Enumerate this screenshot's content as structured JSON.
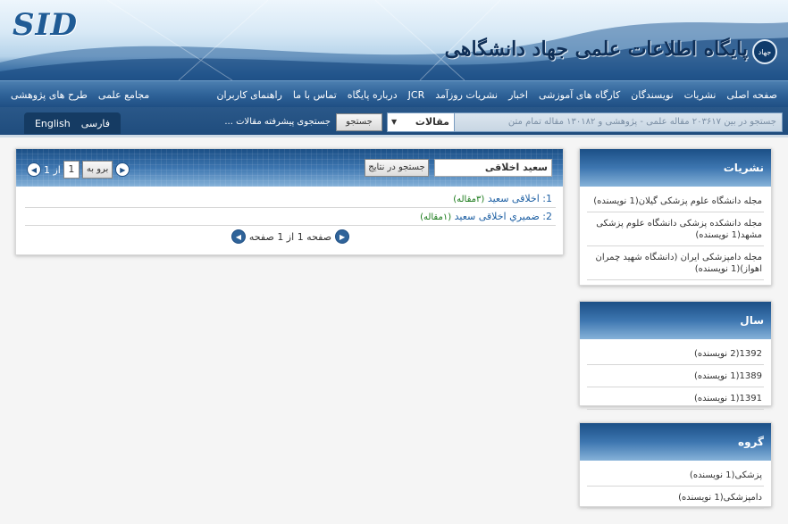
{
  "banner": {
    "logo": "SID",
    "title": "پایگاه اطلاعات علمی جهاد دانشگاهی",
    "emblem": "جهاد"
  },
  "nav": {
    "right_items": [
      "صفحه اصلی",
      "نشریات",
      "نویسندگان",
      "کارگاه های آموزشی",
      "اخبار",
      "نشریات روزآمد",
      "JCR",
      "درباره پایگاه",
      "تماس با ما",
      "راهنمای کاربران"
    ],
    "left_items": [
      "مجامع علمی",
      "طرح های پژوهشی"
    ]
  },
  "search": {
    "placeholder": "جستجو در بین ۲۰۳۶۱۷ مقاله علمی - پژوهشی و ۱۳۰۱۸۲ مقاله تمام متن",
    "type_value": "مقالات",
    "button": "جستجو",
    "advanced": "جستجوی پیشرفته مقالات ...",
    "lang_fa": "فارسی",
    "lang_en": "English"
  },
  "results": {
    "query": "سعید اخلاقی",
    "search_in_results": "جستجو در نتایج",
    "go_label": "برو به",
    "page_value": "1",
    "of_label": "از 1",
    "rows": [
      {
        "num": "1:",
        "name": "اخلاقی سعید",
        "count": "(۳مقاله)"
      },
      {
        "num": "2:",
        "name": "ضميري اخلاقی سعید",
        "count": "(۱مقاله)"
      }
    ],
    "page_status": "صفحه 1 از 1 صفحه"
  },
  "sidebar": {
    "journals": {
      "title": "نشریات",
      "items": [
        "مجله دانشگاه علوم پزشکی گیلان(1 نویسنده)",
        "مجله دانشکده پزشکی دانشگاه علوم پزشکی مشهد(1 نویسنده)",
        "مجله دامپزشکی ایران (دانشگاه شهید چمران اهواز)(1 نویسنده)"
      ]
    },
    "year": {
      "title": "سال",
      "items": [
        "1392(2 نویسنده)",
        "1389(1 نویسنده)",
        "1391(1 نویسنده)"
      ]
    },
    "group": {
      "title": "گروه",
      "items": [
        "پزشکی(1 نویسنده)",
        "دامپزشکی(1 نویسنده)"
      ]
    }
  }
}
